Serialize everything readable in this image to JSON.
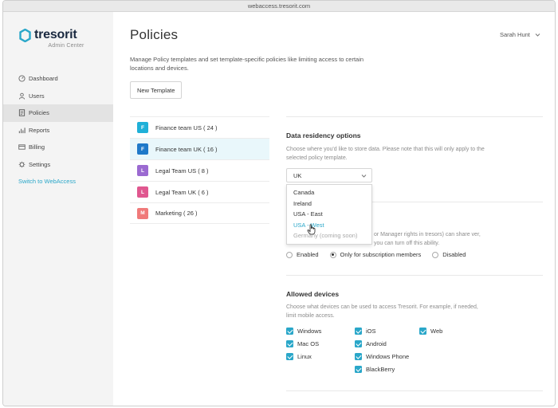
{
  "window": {
    "url": "webaccess.tresorit.com"
  },
  "brand": {
    "name": "tresorit",
    "subtitle": "Admin Center"
  },
  "sidebar": {
    "items": [
      {
        "label": "Dashboard",
        "icon": "dashboard-icon"
      },
      {
        "label": "Users",
        "icon": "user-icon"
      },
      {
        "label": "Policies",
        "icon": "policy-icon",
        "active": true
      },
      {
        "label": "Reports",
        "icon": "chart-icon"
      },
      {
        "label": "Billing",
        "icon": "billing-icon"
      },
      {
        "label": "Settings",
        "icon": "gear-icon"
      }
    ],
    "switch_link": "Switch to WebAccess"
  },
  "header": {
    "title": "Policies",
    "user": "Sarah Hunt"
  },
  "intro": {
    "description": "Manage Policy templates and set template-specific policies like limiting access to certain locations and devices.",
    "new_template_button": "New Template"
  },
  "templates": [
    {
      "badge": "F",
      "label": "Finance team US ( 24 )",
      "color": "#1fb0d8"
    },
    {
      "badge": "F",
      "label": "Finance team UK ( 16 )",
      "color": "#1f79c9",
      "active": true
    },
    {
      "badge": "L",
      "label": "Legal Team US ( 8 )",
      "color": "#9b6ad1"
    },
    {
      "badge": "L",
      "label": "Legal Team UK ( 6 )",
      "color": "#e0578f"
    },
    {
      "badge": "M",
      "label": "Marketing ( 26 )",
      "color": "#f07a7a"
    }
  ],
  "data_residency": {
    "title": "Data residency options",
    "description": "Choose where you'd like to store data. Please note that this will only apply to the selected policy template.",
    "selected": "UK",
    "options": [
      {
        "label": "Canada"
      },
      {
        "label": "Ireland"
      },
      {
        "label": "USA - East"
      },
      {
        "label": "USA - West",
        "highlighted": true
      },
      {
        "label": "Germany (coming soon)",
        "disabled": true
      }
    ]
  },
  "sharing": {
    "text": "or Manager rights in tresors) can share ver, you can turn off this ability.",
    "options": [
      {
        "label": "Enabled",
        "selected": false
      },
      {
        "label": "Only for subscription members",
        "selected": true
      },
      {
        "label": "Disabled",
        "selected": false
      }
    ]
  },
  "allowed_devices": {
    "title": "Allowed devices",
    "description": "Choose what devices can be used to access Tresorit. For example, if needed, limit mobile access.",
    "devices": [
      {
        "label": "Windows",
        "checked": true
      },
      {
        "label": "Mac OS",
        "checked": true
      },
      {
        "label": "Linux",
        "checked": true
      },
      {
        "label": "iOS",
        "checked": true
      },
      {
        "label": "Android",
        "checked": true
      },
      {
        "label": "Windows Phone",
        "checked": true
      },
      {
        "label": "BlackBerry",
        "checked": true
      },
      {
        "label": "Web",
        "checked": true
      }
    ]
  },
  "colors": {
    "accent": "#2aa7c9",
    "brand_dark": "#1a2940",
    "sidebar_bg": "#f4f4f4"
  }
}
